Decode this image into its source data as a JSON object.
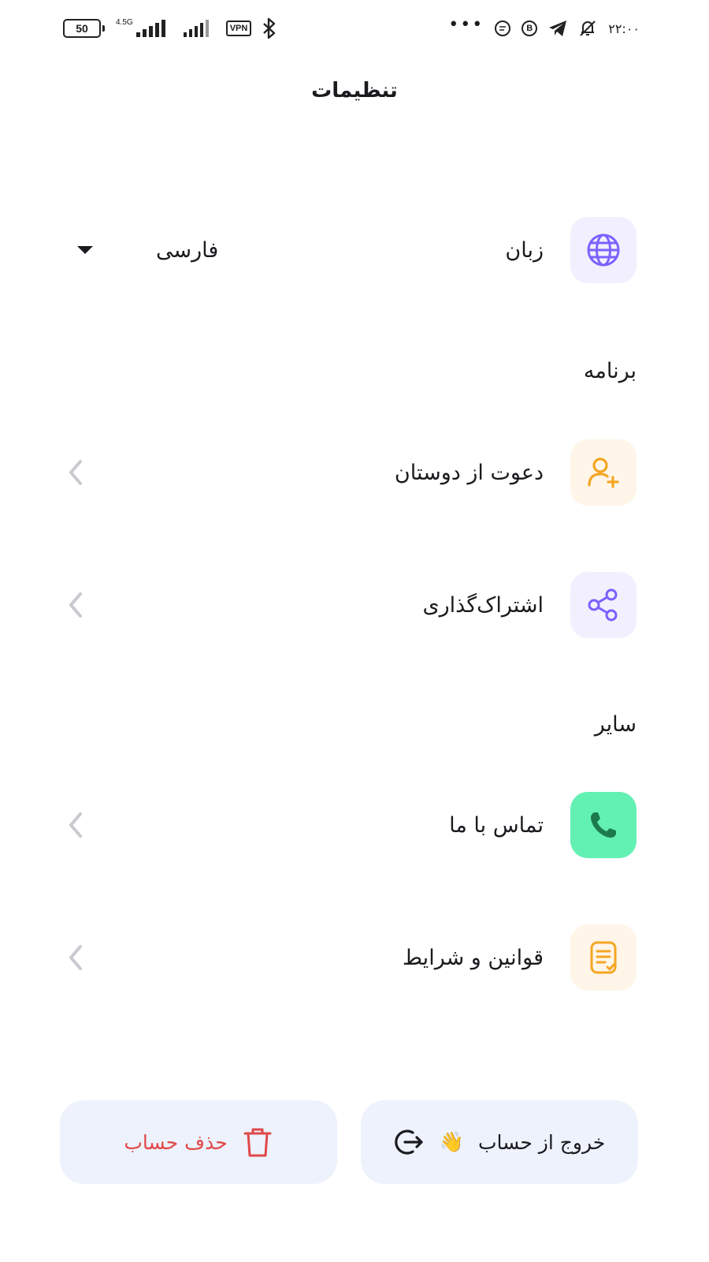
{
  "status_bar": {
    "battery": "50",
    "network_type": "4.5G",
    "vpn": "VPN",
    "overflow": "•••",
    "chat_badge_icon": "chat-bubble-icon",
    "b_badge": "B",
    "time": "۲۲:۰۰"
  },
  "header": {
    "title": "تنظیمات"
  },
  "language": {
    "label": "زبان",
    "value": "فارسی",
    "icon": "globe-icon"
  },
  "sections": {
    "app_title": "برنامه",
    "other_title": "سایر"
  },
  "app_items": [
    {
      "label": "دعوت از دوستان",
      "icon": "user-plus-icon",
      "accent": "#f5a623",
      "bg": "#fff5e8"
    },
    {
      "label": "اشتراک‌گذاری",
      "icon": "share-icon",
      "accent": "#7b61ff",
      "bg": "#f2f0ff"
    }
  ],
  "other_items": [
    {
      "label": "تماس با ما",
      "icon": "phone-icon",
      "accent": "#1d7a4c",
      "bg": "#63f0b3"
    },
    {
      "label": "قوانین و شرایط",
      "icon": "document-check-icon",
      "accent": "#f5a623",
      "bg": "#fff5e8"
    }
  ],
  "actions": {
    "logout_label": "خروج از حساب",
    "logout_emoji": "👋",
    "delete_label": "حذف حساب",
    "delete_color": "#e04848",
    "button_bg": "#edf2fc"
  },
  "colors": {
    "language_icon_bg": "#f2f0ff",
    "language_icon": "#7b61ff",
    "chevron": "#c9c9cf"
  }
}
